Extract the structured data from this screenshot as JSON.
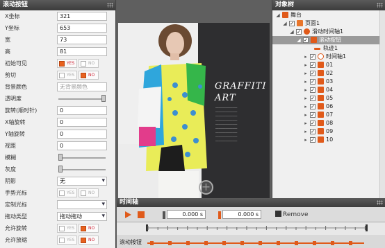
{
  "properties": {
    "title": "滚动按钮",
    "fields": [
      {
        "label": "X坐标",
        "value": "321"
      },
      {
        "label": "Y坐标",
        "value": "653"
      },
      {
        "label": "宽",
        "value": "73"
      },
      {
        "label": "高",
        "value": "81"
      }
    ],
    "visible_label": "初始可见",
    "clip_label": "剪切",
    "bg_color_label": "背景颜色",
    "bg_color_placeholder": "无背景颜色",
    "opacity_label": "透明度",
    "rotation_label": "旋转(顺时针)",
    "rotation_value": "0",
    "x_rotate_label": "X轴旋转",
    "x_rotate_value": "0",
    "y_rotate_label": "Y轴旋转",
    "y_rotate_value": "0",
    "distance_label": "视距",
    "distance_value": "0",
    "blur_label": "模糊",
    "gray_label": "灰度",
    "shadow_label": "阴影",
    "shadow_value": "无",
    "hand_cursor_label": "手势光标",
    "custom_cursor_label": "定制光标",
    "drag_type_label": "拖动类型",
    "drag_type_value": "拖动拖动",
    "allow_rotate_label": "允许旋转",
    "allow_zoom_label": "允许放缩",
    "yes": "YES",
    "no": "NO",
    "opacity": 1.0,
    "blur": 0.0,
    "gray": 0.0
  },
  "stage": {
    "headline_1": "GRAFFITI",
    "headline_2": "ART",
    "add_symbol": "+"
  },
  "tree": {
    "title": "对象树",
    "nodes": [
      {
        "label": "舞台",
        "icon": "stage-icon"
      },
      {
        "label": "页面1",
        "icon": "page-icon"
      },
      {
        "label": "滑动时间轴1",
        "icon": "timeline-icon"
      },
      {
        "label": "滚动按钮",
        "icon": "scroll-button-icon"
      },
      {
        "label": "轨迹1",
        "icon": "track-icon"
      },
      {
        "label": "时间轴1",
        "icon": "clock-icon"
      },
      {
        "label": "01",
        "icon": "image-icon"
      },
      {
        "label": "02",
        "icon": "image-icon"
      },
      {
        "label": "03",
        "icon": "image-icon"
      },
      {
        "label": "04",
        "icon": "image-icon"
      },
      {
        "label": "05",
        "icon": "image-icon"
      },
      {
        "label": "06",
        "icon": "image-icon"
      },
      {
        "label": "07",
        "icon": "image-icon"
      },
      {
        "label": "08",
        "icon": "image-icon"
      },
      {
        "label": "09",
        "icon": "image-icon"
      },
      {
        "label": "10",
        "icon": "image-icon"
      }
    ]
  },
  "timeline": {
    "title": "时间轴",
    "start_time": "0.000 s",
    "end_time": "0.000 s",
    "remove_label": "Remove",
    "track_label": "滚动按钮"
  },
  "colors": {
    "accent": "#e05a1a",
    "panel_header": "#3c3c3c",
    "selection": "#9a9a9a"
  }
}
